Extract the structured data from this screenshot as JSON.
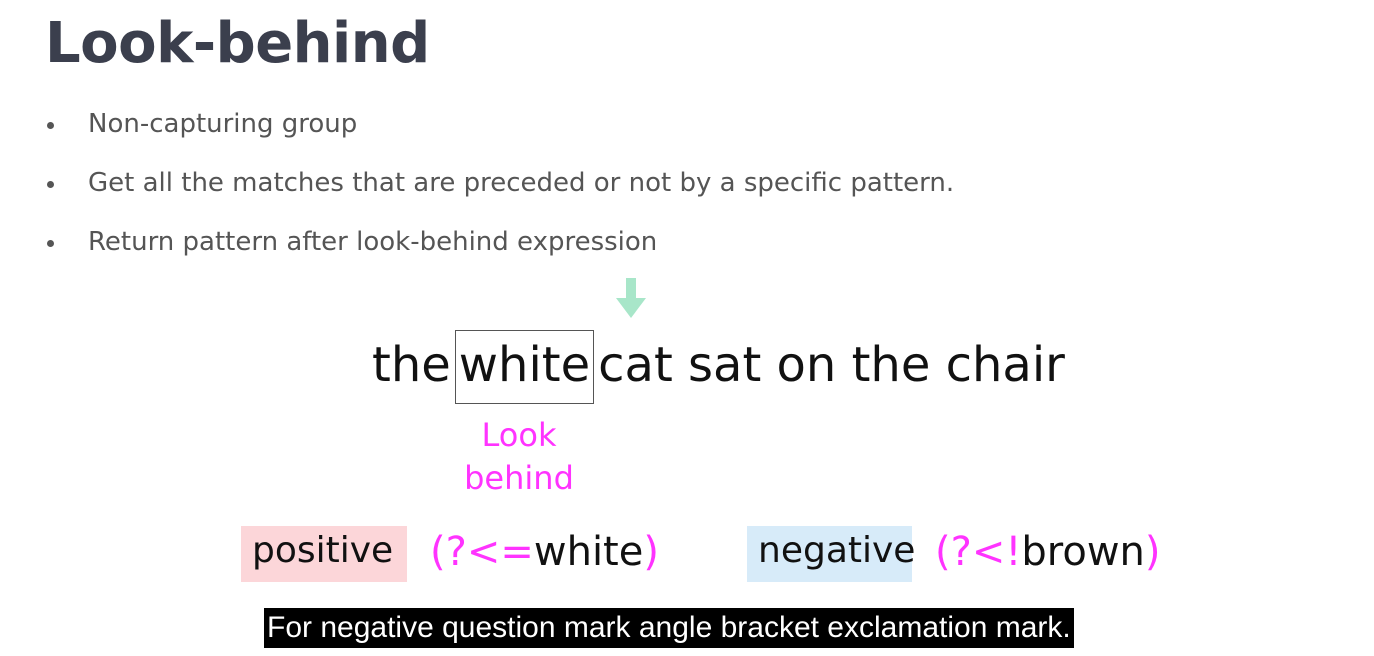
{
  "slide": {
    "title": "Look-behind",
    "bullets": [
      "Non-capturing group",
      "Get all the matches that are preceded or not by a specific pattern.",
      "Return pattern after look-behind expression"
    ]
  },
  "example": {
    "word_before": "the",
    "highlighted_word": "white",
    "word_after": "cat sat on the chair",
    "annotation_line1": "Look",
    "annotation_line2": "behind",
    "arrow_icon": "down-arrow-icon"
  },
  "syntax": {
    "positive_label": "positive",
    "positive_open": "(?<=",
    "positive_word": "white",
    "positive_close": ")",
    "negative_label": "negative",
    "negative_open": "(?<!",
    "negative_word": "brown",
    "negative_close": ")"
  },
  "caption": {
    "text": "For negative question mark angle bracket exclamation mark."
  },
  "colors": {
    "accent_magenta": "#ff33ff",
    "arrow_green": "#a8e6c9",
    "positive_bg": "#fcd6d9",
    "negative_bg": "#d7ebf9",
    "title_color": "#3b3f4d"
  }
}
